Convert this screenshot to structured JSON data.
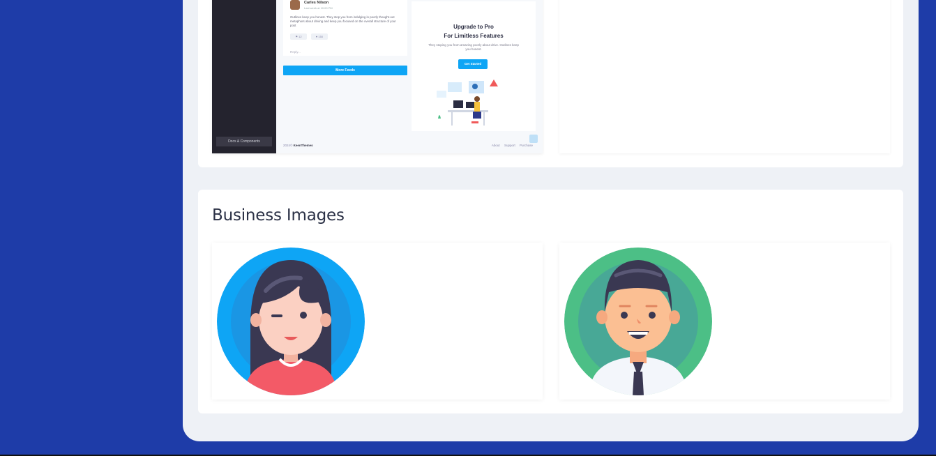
{
  "preview": {
    "sidebar_button": "Docs & Components",
    "feed": {
      "author": "Carles Nilson",
      "time": "Last week at 10:00 PM",
      "text": "Outlines keep you honest. They stop you from indulging in poorly thought-out metaphors about driving and keep you focused on the overall structure of your post",
      "likes": "12",
      "hearts": "150",
      "reply_placeholder": "Reply...",
      "more_button": "More Feeds"
    },
    "promo": {
      "title_line1": "Upgrade to Pro",
      "title_line2": "For Limitless Features",
      "text": "They stoping you from amazing poorly about drive. Outlines keep you honest.",
      "button": "Get Started"
    },
    "footer": {
      "year": "2024©",
      "brand": "KeenThemes",
      "links": [
        "About",
        "Support",
        "Purchase"
      ]
    }
  },
  "business": {
    "title": "Business Images"
  },
  "colors": {
    "page_background": "#1e3ca8",
    "accent": "#0ea5f5",
    "avatar_female_bg": "#0ea5f5",
    "avatar_male_bg": "#4cbf86"
  }
}
